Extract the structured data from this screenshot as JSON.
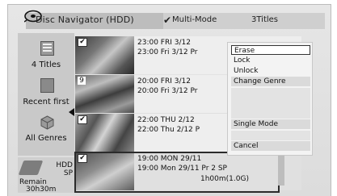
{
  "header": {
    "title": "Disc Navigator (HDD)",
    "check_glyph": "✔",
    "mode": "Multi-Mode",
    "count": "3Titles"
  },
  "sidebar": {
    "items": [
      {
        "label": "4 Titles",
        "icon": "list-icon"
      },
      {
        "label": "Recent first",
        "icon": "square-icon"
      },
      {
        "label": "All Genres",
        "icon": "box-icon"
      }
    ],
    "disk": {
      "line1": "HDD",
      "line2": "SP",
      "line3": "Remain",
      "line4": "30h30m"
    }
  },
  "titles": [
    {
      "checked": true,
      "badge": "✔",
      "line1": "23:00  FRI   3/12",
      "line2": "23:00   Fri   3/12   Pr",
      "line3": ""
    },
    {
      "checked": false,
      "badge": "9",
      "line1": "20:00  FRI   3/12",
      "line2": "20:00    Fri   3/12   Pr",
      "line3": ""
    },
    {
      "checked": true,
      "badge": "✔",
      "line1": "22:00  THU   2/12",
      "line2": "22:00    Thu   2/12   P",
      "line3": ""
    },
    {
      "checked": true,
      "badge": "✔",
      "line1": "19:00   MON   29/11",
      "line2": "19:00    Mon   29/11   Pr 2   SP",
      "line3": "1h00m(1.0G)"
    }
  ],
  "menu": {
    "items": [
      "Erase",
      "Lock",
      "Unlock",
      "Change Genre",
      "Single Mode",
      "Cancel"
    ],
    "active_index": 0
  }
}
